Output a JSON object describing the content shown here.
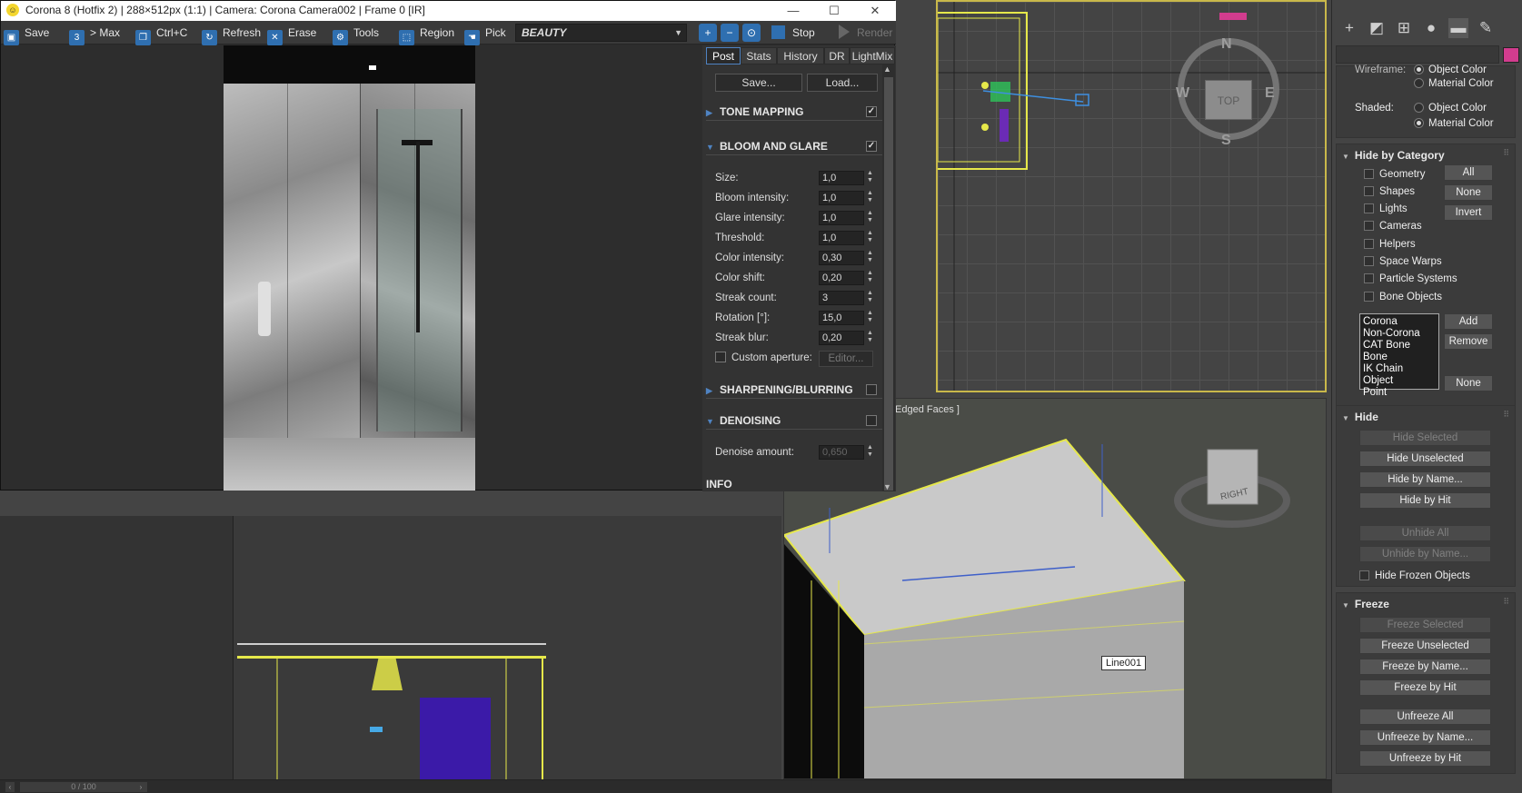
{
  "vfb": {
    "title": "Corona 8 (Hotfix 2) | 288×512px (1:1) | Camera: Corona Camera002 | Frame 0 [IR]",
    "toolbar": {
      "save": "Save",
      "to_max": "> Max",
      "copy": "Ctrl+C",
      "refresh": "Refresh",
      "erase": "Erase",
      "tools": "Tools",
      "region": "Region",
      "pick": "Pick",
      "channel": "BEAUTY",
      "stop": "Stop",
      "render": "Render"
    },
    "tabs": [
      "Post",
      "Stats",
      "History",
      "DR",
      "LightMix"
    ],
    "active_tab": "Post",
    "buttons": {
      "save": "Save...",
      "load": "Load..."
    },
    "sections": {
      "tone_mapping": {
        "label": "TONE MAPPING",
        "checked": true
      },
      "bloom_glare": {
        "label": "BLOOM AND GLARE",
        "checked": true
      },
      "sharpen": {
        "label": "SHARPENING/BLURRING",
        "checked": false
      },
      "denoising": {
        "label": "DENOISING",
        "checked": false
      },
      "info": {
        "label": "INFO"
      }
    },
    "bloom_params": [
      {
        "label": "Size:",
        "value": "1,0"
      },
      {
        "label": "Bloom intensity:",
        "value": "1,0"
      },
      {
        "label": "Glare intensity:",
        "value": "1,0"
      },
      {
        "label": "Threshold:",
        "value": "1,0"
      },
      {
        "label": "Color intensity:",
        "value": "0,30"
      },
      {
        "label": "Color shift:",
        "value": "0,20"
      },
      {
        "label": "Streak count:",
        "value": "3"
      },
      {
        "label": "Rotation [°]:",
        "value": "15,0"
      },
      {
        "label": "Streak blur:",
        "value": "0,20"
      }
    ],
    "custom_aperture": {
      "label": "Custom aperture:",
      "editor": "Editor..."
    },
    "denoise_amount": {
      "label": "Denoise amount:",
      "value": "0,650"
    }
  },
  "viewports": {
    "persp_label": "Edged Faces ]",
    "line_tag": "Line001",
    "compass": {
      "n": "N",
      "e": "E",
      "s": "S",
      "w": "W",
      "cube": "TOP"
    },
    "viewcube_right": "RIGHT",
    "frame_counter": "0 / 100"
  },
  "cmd": {
    "display_wireframe_label": "Wireframe:",
    "wire_options": [
      "Object Color",
      "Material Color"
    ],
    "shaded_label": "Shaded:",
    "shaded_options": [
      "Object Color",
      "Material Color"
    ],
    "hide_by_category": {
      "title": "Hide by Category",
      "items": [
        "Geometry",
        "Shapes",
        "Lights",
        "Cameras",
        "Helpers",
        "Space Warps",
        "Particle Systems",
        "Bone Objects"
      ],
      "btn_all": "All",
      "btn_none": "None",
      "btn_invert": "Invert",
      "list": [
        "Corona",
        "Non-Corona",
        "CAT Bone",
        "Bone",
        "IK Chain Object",
        "Point"
      ],
      "btn_add": "Add",
      "btn_remove": "Remove",
      "btn_none2": "None"
    },
    "hide": {
      "title": "Hide",
      "buttons": [
        "Hide Selected",
        "Hide Unselected",
        "Hide by Name...",
        "Hide by Hit",
        "Unhide All",
        "Unhide by Name..."
      ],
      "frozen": "Hide Frozen Objects"
    },
    "freeze": {
      "title": "Freeze",
      "buttons": [
        "Freeze Selected",
        "Freeze Unselected",
        "Freeze by Name...",
        "Freeze by Hit",
        "Unfreeze All",
        "Unfreeze by Name...",
        "Unfreeze by Hit"
      ]
    },
    "swatch_color": "#d23c8e"
  }
}
